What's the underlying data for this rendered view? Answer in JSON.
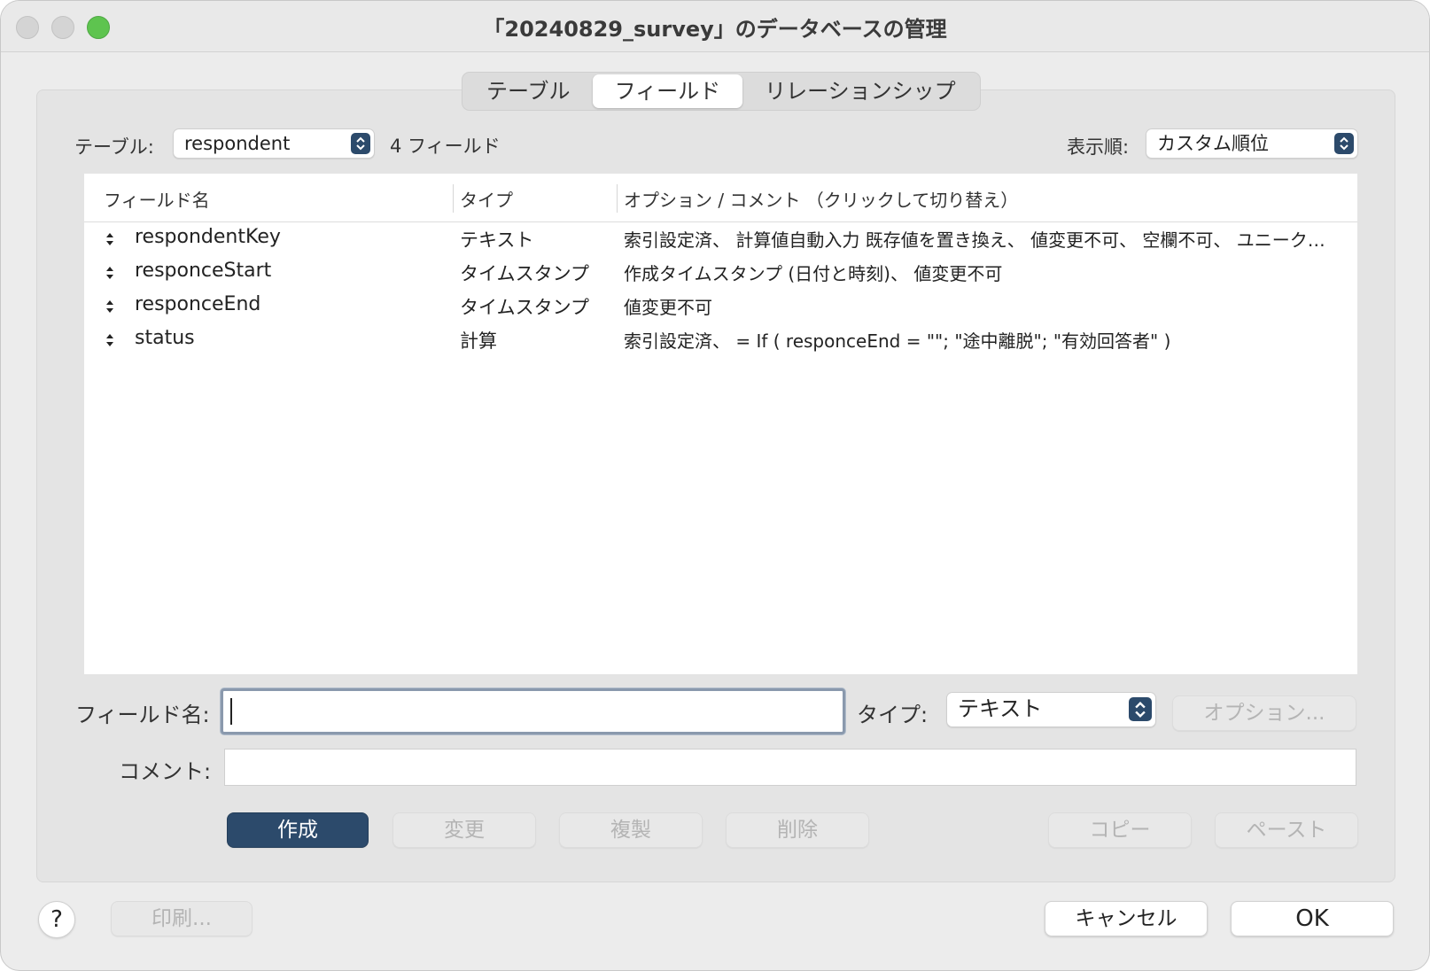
{
  "window": {
    "title": "「20240829_survey」のデータベースの管理"
  },
  "tabs": [
    {
      "label": "テーブル"
    },
    {
      "label": "フィールド"
    },
    {
      "label": "リレーションシップ"
    }
  ],
  "top": {
    "table_label": "テーブル:",
    "table_value": "respondent",
    "field_count": "4 フィールド",
    "order_label": "表示順:",
    "order_value": "カスタム順位"
  },
  "table": {
    "headers": [
      "フィールド名",
      "タイプ",
      "オプション / コメント （クリックして切り替え）"
    ],
    "rows": [
      {
        "name": "respondentKey",
        "type": "テキスト",
        "options": "索引設定済、 計算値自動入力  既存値を置き換え、 値変更不可、 空欄不可、 ユニーク…"
      },
      {
        "name": "responceStart",
        "type": "タイムスタンプ",
        "options": "作成タイムスタンプ (日付と時刻)、 値変更不可"
      },
      {
        "name": "responceEnd",
        "type": "タイムスタンプ",
        "options": "値変更不可"
      },
      {
        "name": "status",
        "type": "計算",
        "options": "索引設定済、 = If ( responceEnd = \"\"; \"途中離脱\"; \"有効回答者\" )"
      }
    ]
  },
  "form": {
    "field_name_label": "フィールド名:",
    "field_name_value": "",
    "type_label": "タイプ:",
    "type_value": "テキスト",
    "options_button": "オプション...",
    "comment_label": "コメント:",
    "comment_value": ""
  },
  "actions": {
    "create": "作成",
    "change": "変更",
    "duplicate": "複製",
    "delete": "削除",
    "copy": "コピー",
    "paste": "ペースト"
  },
  "footer": {
    "help": "?",
    "print": "印刷...",
    "cancel": "キャンセル",
    "ok": "OK"
  }
}
